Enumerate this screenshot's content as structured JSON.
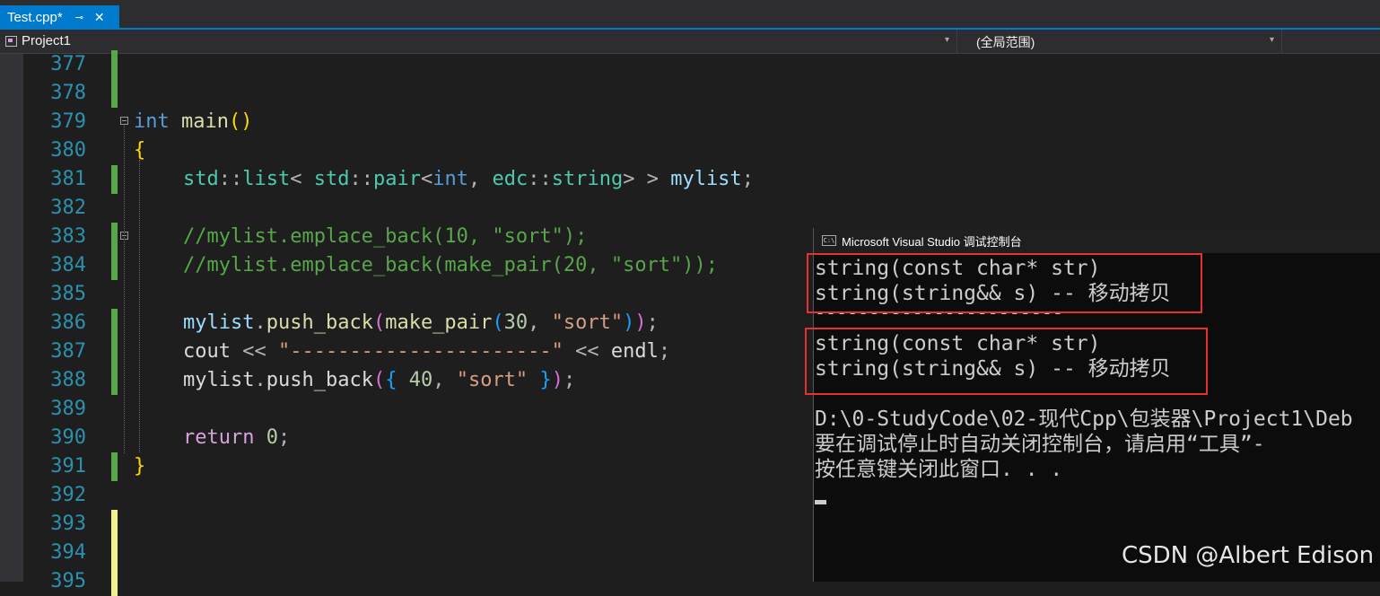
{
  "tab": {
    "title": "Test.cpp*",
    "pin": "⊸",
    "close": "✕"
  },
  "nav": {
    "project": "Project1",
    "scope": "(全局范围)",
    "dropdown_glyph": "▾"
  },
  "code_lines": [
    {
      "num": "377",
      "change": "saved"
    },
    {
      "num": "378",
      "change": "saved"
    },
    {
      "num": "379",
      "change": "none"
    },
    {
      "num": "380",
      "change": "none"
    },
    {
      "num": "381",
      "change": "saved"
    },
    {
      "num": "382",
      "change": "none"
    },
    {
      "num": "383",
      "change": "saved"
    },
    {
      "num": "384",
      "change": "saved"
    },
    {
      "num": "385",
      "change": "none"
    },
    {
      "num": "386",
      "change": "saved"
    },
    {
      "num": "387",
      "change": "saved"
    },
    {
      "num": "388",
      "change": "saved"
    },
    {
      "num": "389",
      "change": "none"
    },
    {
      "num": "390",
      "change": "none"
    },
    {
      "num": "391",
      "change": "saved"
    },
    {
      "num": "392",
      "change": "none"
    },
    {
      "num": "393",
      "change": "unsaved"
    },
    {
      "num": "394",
      "change": "unsaved"
    },
    {
      "num": "395",
      "change": "unsaved"
    }
  ],
  "code_tokens": {
    "l379": {
      "kw": "int",
      "fn": "main",
      "p1": "(",
      "p2": ")"
    },
    "l380": {
      "brace": "{"
    },
    "l381": {
      "a": "std",
      "b": "::",
      "c": "list",
      "d": "< ",
      "e": "std",
      "f": "::",
      "g": "pair",
      "h": "<",
      "i": "int",
      "j": ", ",
      "k": "edc",
      "l": "::",
      "m": "string",
      "n": ">",
      "o": " > ",
      "p": "mylist",
      "q": ";"
    },
    "l383": {
      "comment": "//mylist.emplace_back(10, \"sort\");"
    },
    "l384": {
      "comment": "//mylist.emplace_back(make_pair(20, \"sort\"));"
    },
    "l386": {
      "a": "mylist",
      "b": ".",
      "c": "push_back",
      "d": "(",
      "e": "make_pair",
      "f": "(",
      "g": "30",
      "h": ", ",
      "i": "\"sort\"",
      "j": ")",
      "k": ")",
      "l": ";"
    },
    "l387": {
      "a": "cout",
      "b": " << ",
      "c": "\"----------------------\"",
      "d": " << ",
      "e": "endl",
      "f": ";"
    },
    "l388": {
      "a": "mylist",
      "b": ".",
      "c": "push_back",
      "d": "(",
      "e": "{",
      "f": " ",
      "g": "40",
      "h": ", ",
      "i": "\"sort\"",
      "j": " ",
      "k": "}",
      "l": ")",
      "m": ";"
    },
    "l390": {
      "kw": "return",
      "num": " 0",
      "semi": ";"
    },
    "l391": {
      "brace": "}"
    }
  },
  "console": {
    "title": "Microsoft Visual Studio 调试控制台",
    "icon": "C:\\",
    "lines": [
      "string(const char* str)",
      "string(string&& s) -- 移动拷贝",
      "-----------------------",
      "string(const char* str)",
      "string(string&& s) -- 移动拷贝",
      "",
      "D:\\0-StudyCode\\02-现代Cpp\\包装器\\Project1\\Deb",
      "要在调试停止时自动关闭控制台，请启用“工具”-",
      "按任意键关闭此窗口. . ."
    ]
  },
  "watermark": "CSDN @Albert Edison",
  "colors": {
    "accent": "#007acc",
    "saved_change": "#57a64a",
    "unsaved_change": "#efef91",
    "highlight_box": "#e8312f"
  }
}
